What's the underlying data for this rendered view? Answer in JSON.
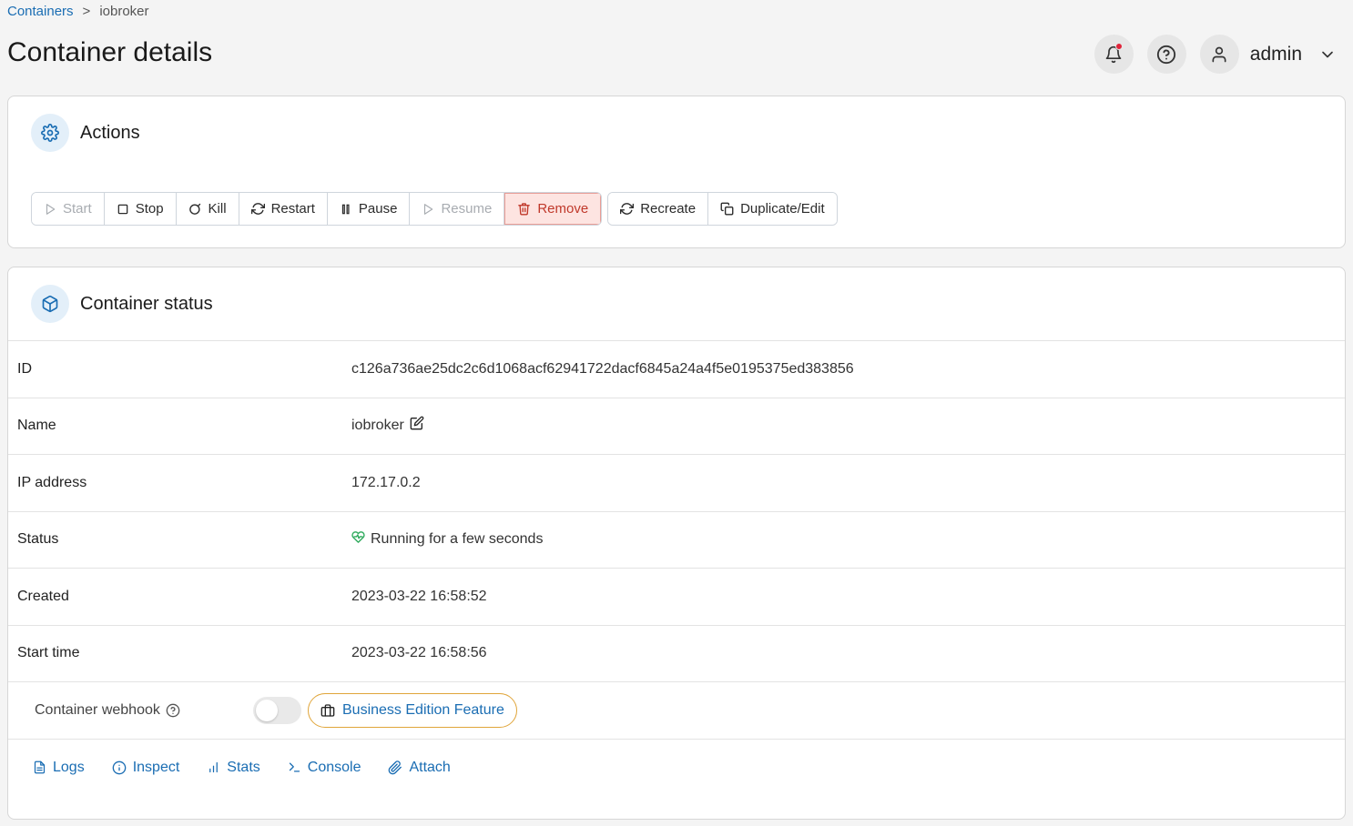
{
  "breadcrumb": {
    "parent": "Containers",
    "separator": ">",
    "current": "iobroker"
  },
  "page_title": "Container details",
  "header": {
    "user_name": "admin"
  },
  "actions_card": {
    "title": "Actions",
    "buttons": {
      "start": "Start",
      "stop": "Stop",
      "kill": "Kill",
      "restart": "Restart",
      "pause": "Pause",
      "resume": "Resume",
      "remove": "Remove",
      "recreate": "Recreate",
      "duplicate": "Duplicate/Edit"
    }
  },
  "status_card": {
    "title": "Container status",
    "rows": [
      {
        "label": "ID",
        "value": "c126a736ae25dc2c6d1068acf62941722dacf6845a24a4f5e0195375ed383856"
      },
      {
        "label": "Name",
        "value": "iobroker"
      },
      {
        "label": "IP address",
        "value": "172.17.0.2"
      },
      {
        "label": "Status",
        "value": "Running for a few seconds"
      },
      {
        "label": "Created",
        "value": "2023-03-22 16:58:52"
      },
      {
        "label": "Start time",
        "value": "2023-03-22 16:58:56"
      }
    ],
    "webhook_label": "Container webhook",
    "webhook_enabled": false,
    "business_badge": "Business Edition Feature",
    "links": {
      "logs": "Logs",
      "inspect": "Inspect",
      "stats": "Stats",
      "console": "Console",
      "attach": "Attach"
    }
  },
  "colors": {
    "accent": "#1a6db3",
    "danger": "#c0392b",
    "danger_bg": "#fde4e1",
    "healthy": "#2eaa5c",
    "badge_border": "#e0a53a"
  }
}
